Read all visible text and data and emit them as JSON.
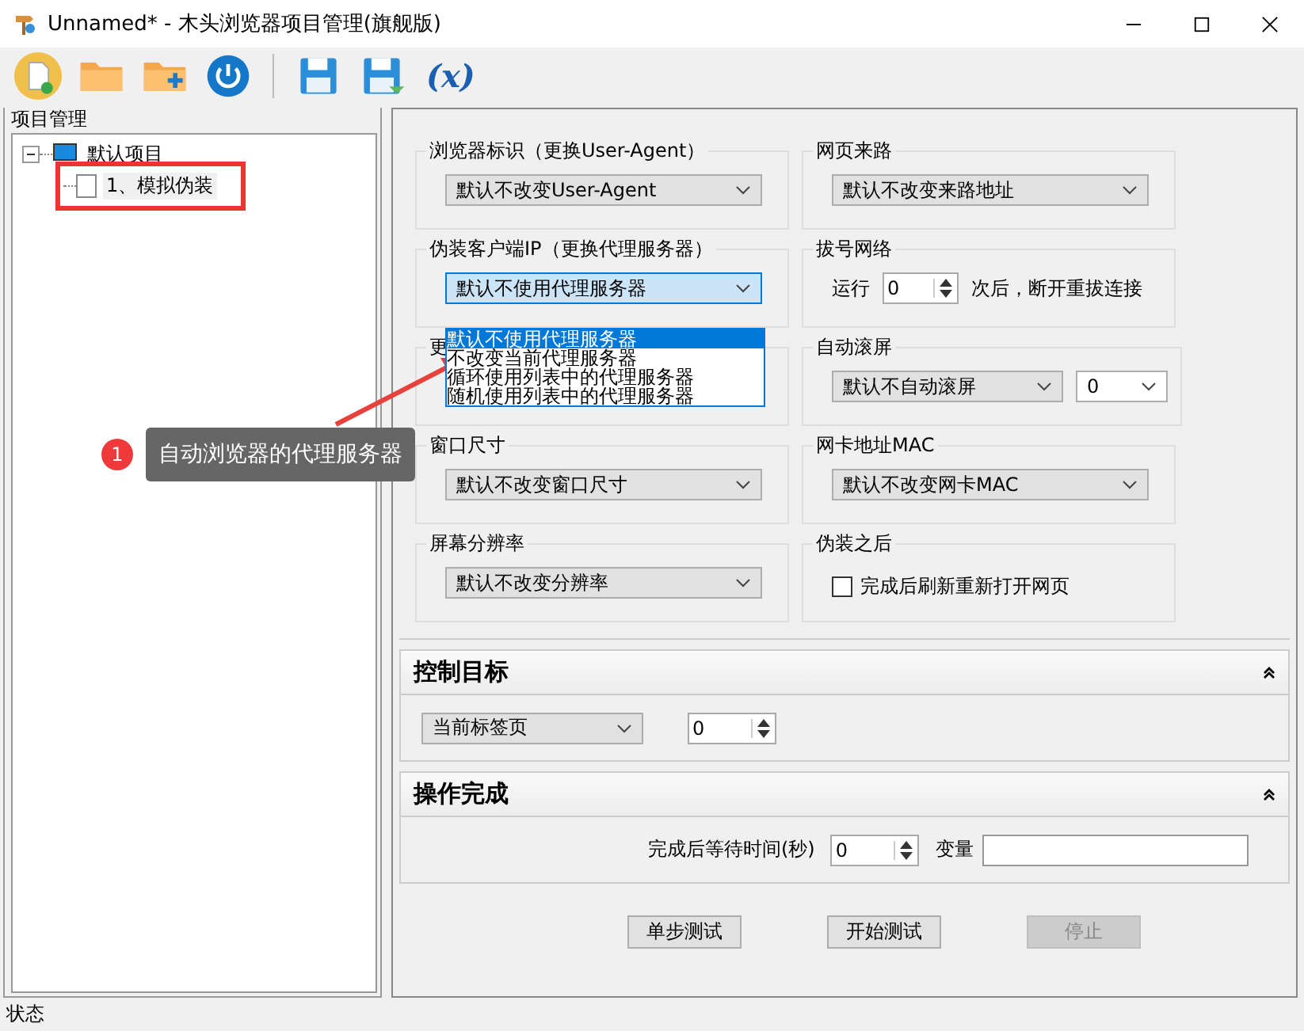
{
  "window": {
    "title": "Unnamed* - 木头浏览器项目管理(旗舰版)"
  },
  "toolbar": {
    "variable_label": "(x)"
  },
  "project_panel": {
    "title": "项目管理",
    "tree": [
      {
        "label": "默认项目",
        "expanded": true,
        "children": [
          {
            "label": "1、模拟伪装",
            "checked": false,
            "highlighted": true
          }
        ]
      }
    ]
  },
  "settings": [
    {
      "kind": "combo",
      "label": "浏览器标识（更换User-Agent）",
      "value": "默认不改变User-Agent"
    },
    {
      "kind": "combo",
      "label": "网页来路",
      "value": "默认不改变来路地址"
    },
    {
      "kind": "combo",
      "label": "伪装客户端IP（更换代理服务器）",
      "value": "默认不使用代理服务器",
      "open": true,
      "options": [
        {
          "label": "默认不使用代理服务器",
          "selected": true
        },
        {
          "label": "不改变当前代理服务器",
          "selected": false
        },
        {
          "label": "循环使用列表中的代理服务器",
          "selected": false
        },
        {
          "label": "随机使用列表中的代理服务器",
          "selected": false
        }
      ]
    },
    {
      "kind": "spin",
      "label": "拔号网络",
      "prefix": "运行",
      "value": "0",
      "suffix": "次后，断开重拔连接"
    },
    {
      "kind": "combo",
      "label": "更"
    },
    {
      "kind": "combo_pair",
      "label": "自动滚屏",
      "value": "默认不自动滚屏",
      "value2": "0"
    },
    {
      "kind": "combo",
      "label": "窗口尺寸",
      "value": "默认不改变窗口尺寸"
    },
    {
      "kind": "combo",
      "label": "网卡地址MAC",
      "value": "默认不改变网卡MAC"
    },
    {
      "kind": "combo",
      "label": "屏幕分辨率",
      "value": "默认不改变分辨率"
    },
    {
      "kind": "checkbox",
      "label": "伪装之后",
      "text": "完成后刷新重新打开网页",
      "checked": false
    }
  ],
  "sections": [
    {
      "kind": "target",
      "title": "控制目标",
      "expanded": true,
      "combo": "当前标签页",
      "spin": "0"
    },
    {
      "kind": "finish",
      "title": "操作完成",
      "expanded": true,
      "wait_label": "完成后等待时间(秒)",
      "spin": "0",
      "var_label": "变量"
    }
  ],
  "buttons": [
    {
      "label": "单步测试",
      "disabled": false
    },
    {
      "label": "开始测试",
      "disabled": false
    },
    {
      "label": "停止",
      "disabled": true
    }
  ],
  "annotation": {
    "number": "1",
    "text": "自动浏览器的代理服务器"
  },
  "status_bar": "状态"
}
